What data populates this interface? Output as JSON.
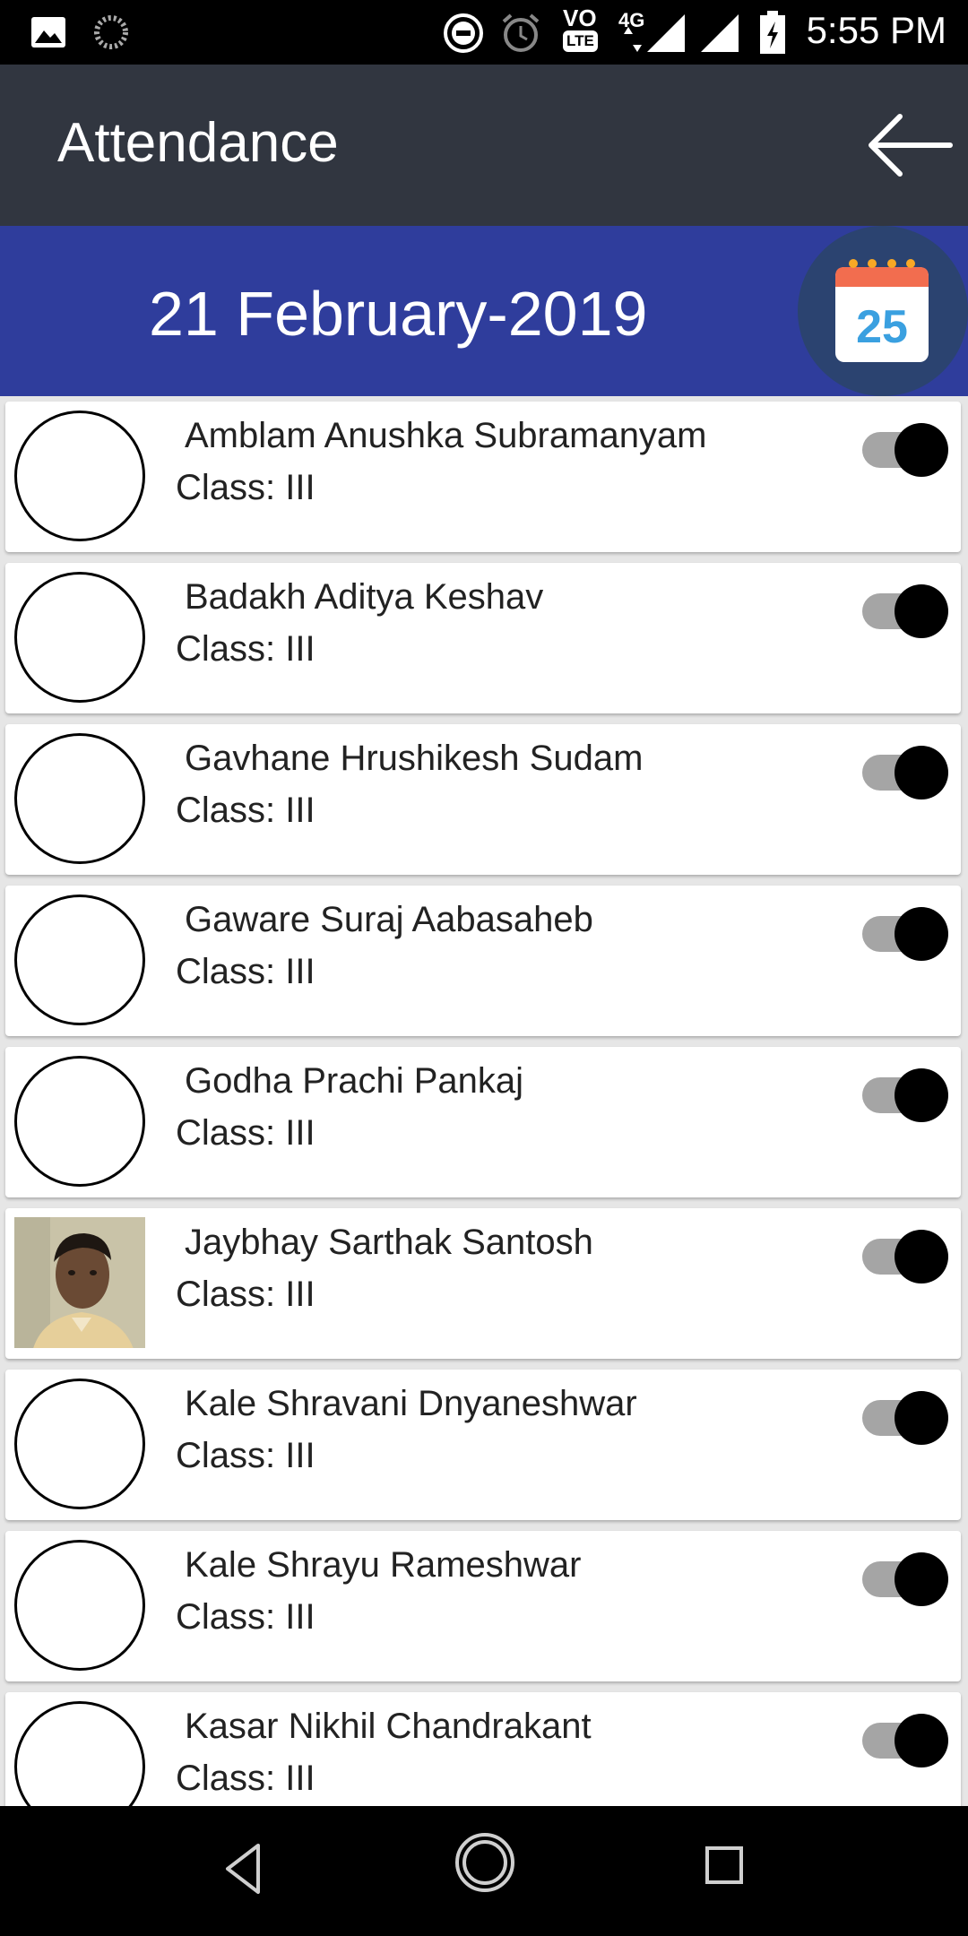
{
  "status_bar": {
    "time": "5:55 PM",
    "network": "4G",
    "volte": "VO",
    "lte": "LTE",
    "icons": [
      "image-icon",
      "loading-icon",
      "dnd-icon",
      "alarm-icon",
      "volte-icon",
      "signal-icon",
      "signal-icon-2",
      "battery-charging-icon"
    ]
  },
  "app_bar": {
    "title": "Attendance",
    "back_icon": "arrow-left-icon"
  },
  "date_bar": {
    "date": "21 February-2019",
    "calendar_icon": "calendar-icon",
    "calendar_day": "25",
    "accent": "#2f3d9c"
  },
  "students": [
    {
      "name": "Amblam Anushka Subramanyam",
      "class": "Class: III",
      "photo": false,
      "present": true
    },
    {
      "name": "Badakh Aditya Keshav",
      "class": "Class: III",
      "photo": false,
      "present": true
    },
    {
      "name": "Gavhane Hrushikesh Sudam",
      "class": "Class: III",
      "photo": false,
      "present": true
    },
    {
      "name": "Gaware Suraj Aabasaheb",
      "class": "Class: III",
      "photo": false,
      "present": true
    },
    {
      "name": "Godha Prachi Pankaj",
      "class": "Class: III",
      "photo": false,
      "present": true
    },
    {
      "name": "Jaybhay Sarthak Santosh",
      "class": "Class: III",
      "photo": true,
      "present": true
    },
    {
      "name": "Kale Shravani Dnyaneshwar",
      "class": "Class: III",
      "photo": false,
      "present": true
    },
    {
      "name": "Kale Shrayu Rameshwar",
      "class": "Class: III",
      "photo": false,
      "present": true
    },
    {
      "name": "Kasar Nikhil Chandrakant",
      "class": "Class: III",
      "photo": false,
      "present": true
    }
  ],
  "nav_bar": {
    "icons": [
      "back-triangle-icon",
      "home-circle-icon",
      "recents-square-icon"
    ]
  }
}
